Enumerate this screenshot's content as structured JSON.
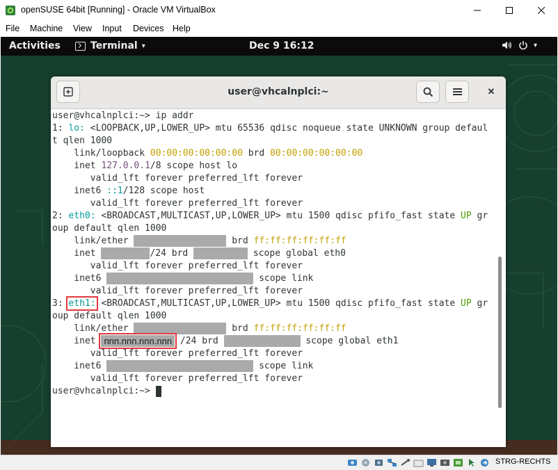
{
  "window": {
    "title": "openSUSE 64bit [Running] - Oracle VM VirtualBox",
    "controls": {
      "minimize": "─",
      "maximize": "☐",
      "close": "✕"
    }
  },
  "menu": [
    "File",
    "Machine",
    "View",
    "Input",
    "Devices",
    "Help"
  ],
  "gnome": {
    "activities": "Activities",
    "app_name": "Terminal",
    "app_arrow": "▾",
    "clock": "Dec 9  16:12",
    "tray_arrow": "▾"
  },
  "terminal": {
    "title": "user@vhcalnplci:~",
    "close_glyph": "✕",
    "lines": [
      [
        {
          "t": "user@vhcalnplci:~> ip addr"
        }
      ],
      [
        {
          "t": "1: "
        },
        {
          "t": "lo:",
          "c": "cyan"
        },
        {
          "t": " <LOOPBACK,UP,LOWER_UP> mtu 65536 qdisc noqueue state UNKNOWN group defaul"
        }
      ],
      [
        {
          "t": "t qlen 1000"
        }
      ],
      [
        {
          "t": "    link/loopback "
        },
        {
          "t": "00:00:00:00:00:00",
          "c": "yellow"
        },
        {
          "t": " brd "
        },
        {
          "t": "00:00:00:00:00:00",
          "c": "yellow"
        }
      ],
      [
        {
          "t": "    inet "
        },
        {
          "t": "127.0.0.1",
          "c": "purple"
        },
        {
          "t": "/8 scope host lo"
        }
      ],
      [
        {
          "t": "       valid_lft forever preferred_lft forever"
        }
      ],
      [
        {
          "t": "    inet6 "
        },
        {
          "t": "::1",
          "c": "cyan"
        },
        {
          "t": "/128 scope host"
        }
      ],
      [
        {
          "t": "       valid_lft forever preferred_lft forever"
        }
      ],
      [
        {
          "t": "2: "
        },
        {
          "t": "eth0:",
          "c": "cyan"
        },
        {
          "t": " <BROADCAST,MULTICAST,UP,LOWER_UP> mtu 1500 qdisc pfifo_fast state "
        },
        {
          "t": "UP",
          "c": "green"
        },
        {
          "t": " gr"
        }
      ],
      [
        {
          "t": "oup default qlen 1000"
        }
      ],
      [
        {
          "t": "    link/ether "
        },
        {
          "m": 17
        },
        {
          "t": " brd "
        },
        {
          "t": "ff:ff:ff:ff:ff:ff",
          "c": "yellow"
        }
      ],
      [
        {
          "t": "    inet "
        },
        {
          "m": 9
        },
        {
          "t": "/24 brd "
        },
        {
          "m": 10
        },
        {
          "t": " scope global eth0"
        }
      ],
      [
        {
          "t": "       valid_lft forever preferred_lft forever"
        }
      ],
      [
        {
          "t": "    inet6 "
        },
        {
          "m": 27
        },
        {
          "t": " scope link"
        }
      ],
      [
        {
          "t": "       valid_lft forever preferred_lft forever"
        }
      ],
      [
        {
          "t": "3: "
        },
        {
          "t": "eth1:",
          "c": "cyan",
          "box": true
        },
        {
          "t": " <BROADCAST,MULTICAST,UP,LOWER_UP> mtu 1500 qdisc pfifo_fast state "
        },
        {
          "t": "UP",
          "c": "green"
        },
        {
          "t": " gr"
        }
      ],
      [
        {
          "t": "oup default qlen 1000"
        }
      ],
      [
        {
          "t": "    link/ether "
        },
        {
          "m": 17
        },
        {
          "t": " brd "
        },
        {
          "t": "ff:ff:ff:ff:ff:ff",
          "c": "yellow"
        }
      ],
      [
        {
          "t": "    inet "
        },
        {
          "redact": "nnn.nnn.nnn.nnn"
        },
        {
          "t": " /24 brd "
        },
        {
          "m": 14
        },
        {
          "t": " scope global eth1"
        }
      ],
      [
        {
          "t": "       valid_lft forever preferred_lft forever"
        }
      ],
      [
        {
          "t": "    inet6 "
        },
        {
          "m": 27
        },
        {
          "t": " scope link"
        }
      ],
      [
        {
          "t": "       valid_lft forever preferred_lft forever"
        }
      ],
      [
        {
          "t": "user@vhcalnplci:~> "
        },
        {
          "cursor": true
        }
      ]
    ]
  },
  "statusbar": {
    "host_key": "STRG-RECHTS"
  },
  "colors": {
    "cyan": "#06989a",
    "yellow": "#c4a000",
    "purple": "#75507b",
    "green": "#4e9a06",
    "annotation_box": "#e0393e",
    "desktop": "#173f2f"
  }
}
